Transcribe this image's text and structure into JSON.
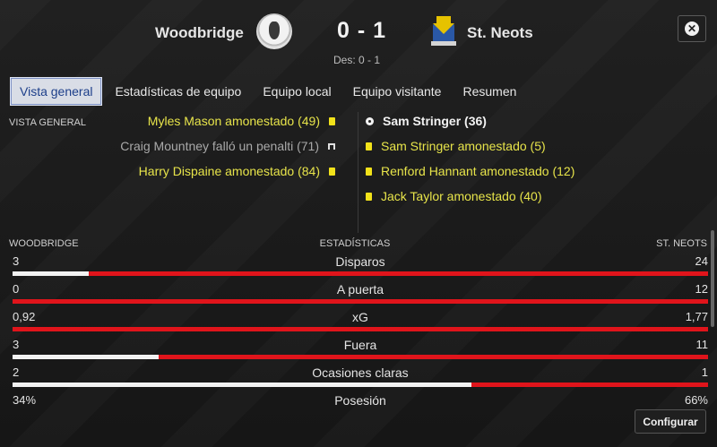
{
  "match": {
    "home_team": "Woodbridge",
    "away_team": "St. Neots",
    "score": "0 - 1",
    "half_time": "Des: 0 - 1"
  },
  "tabs": [
    {
      "label": "Vista general",
      "active": true
    },
    {
      "label": "Estadísticas de equipo",
      "active": false
    },
    {
      "label": "Equipo local",
      "active": false
    },
    {
      "label": "Equipo visitante",
      "active": false
    },
    {
      "label": "Resumen",
      "active": false
    }
  ],
  "section_label": "VISTA GENERAL",
  "home_events": [
    {
      "text": "Myles Mason amonestado (49)",
      "icon": "yellow-card-icon"
    },
    {
      "text": "Craig Mountney falló un penalti (71)",
      "icon": "missed-penalty-icon"
    },
    {
      "text": "Harry Dispaine amonestado (84)",
      "icon": "yellow-card-icon"
    }
  ],
  "away_events": [
    {
      "text": "Sam Stringer (36)",
      "icon": "goal-ball-icon"
    },
    {
      "text": "Sam Stringer amonestado (5)",
      "icon": "yellow-card-icon"
    },
    {
      "text": "Renford Hannant amonestado (12)",
      "icon": "yellow-card-icon"
    },
    {
      "text": "Jack Taylor amonestado (40)",
      "icon": "yellow-card-icon"
    }
  ],
  "stats_header": {
    "home": "WOODBRIDGE",
    "center": "ESTADÍSTICAS",
    "away": "ST. NEOTS"
  },
  "stats": [
    {
      "name": "Disparos",
      "home": "3",
      "away": "24",
      "home_share": 0.11
    },
    {
      "name": "A puerta",
      "home": "0",
      "away": "12",
      "home_share": 0.0
    },
    {
      "name": "xG",
      "home": "0,92",
      "away": "1,77",
      "home_share": 0.0
    },
    {
      "name": "Fuera",
      "home": "3",
      "away": "11",
      "home_share": 0.21
    },
    {
      "name": "Ocasiones claras",
      "home": "2",
      "away": "1",
      "home_share": 0.66
    },
    {
      "name": "Posesión",
      "home": "34%",
      "away": "66%",
      "home_share": 0.34
    }
  ],
  "configure_label": "Configurar",
  "colors": {
    "yellow_text": "#e7e44a",
    "bar_away": "#e0141b",
    "bar_home": "#f2f2f2",
    "tab_active_text": "#1d3f8a"
  }
}
